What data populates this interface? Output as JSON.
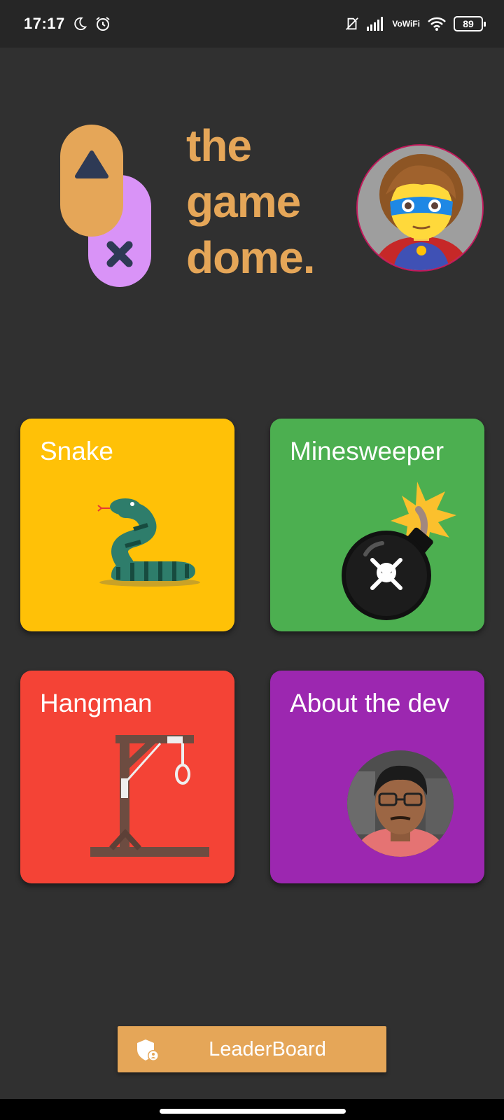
{
  "status_bar": {
    "time": "17:17",
    "volte_top": "Vo",
    "volte_bottom": "WiFi",
    "battery": "89",
    "icons": [
      "moon-icon",
      "alarm-icon",
      "no-sim-icon",
      "signal-icon",
      "volte-wifi-icon",
      "wifi-icon",
      "battery-icon"
    ]
  },
  "header": {
    "title_lines": [
      "the",
      "game",
      "dome."
    ],
    "logo_icon": "gamepad-logo-icon",
    "avatar_icon": "superhero-avatar-icon"
  },
  "games": [
    {
      "label": "Snake",
      "color": "#FFC107",
      "icon": "snake-icon"
    },
    {
      "label": "Minesweeper",
      "color": "#4CAF50",
      "icon": "bomb-icon"
    },
    {
      "label": "Hangman",
      "color": "#F44336",
      "icon": "gallows-icon"
    },
    {
      "label": "About the dev",
      "color": "#9C27B0",
      "icon": "developer-photo"
    }
  ],
  "leaderboard": {
    "label": "LeaderBoard",
    "color": "#E5A658",
    "icon": "shield-user-icon"
  },
  "colors": {
    "background": "#303030",
    "accent": "#E5A658",
    "status_bar": "#262626"
  }
}
